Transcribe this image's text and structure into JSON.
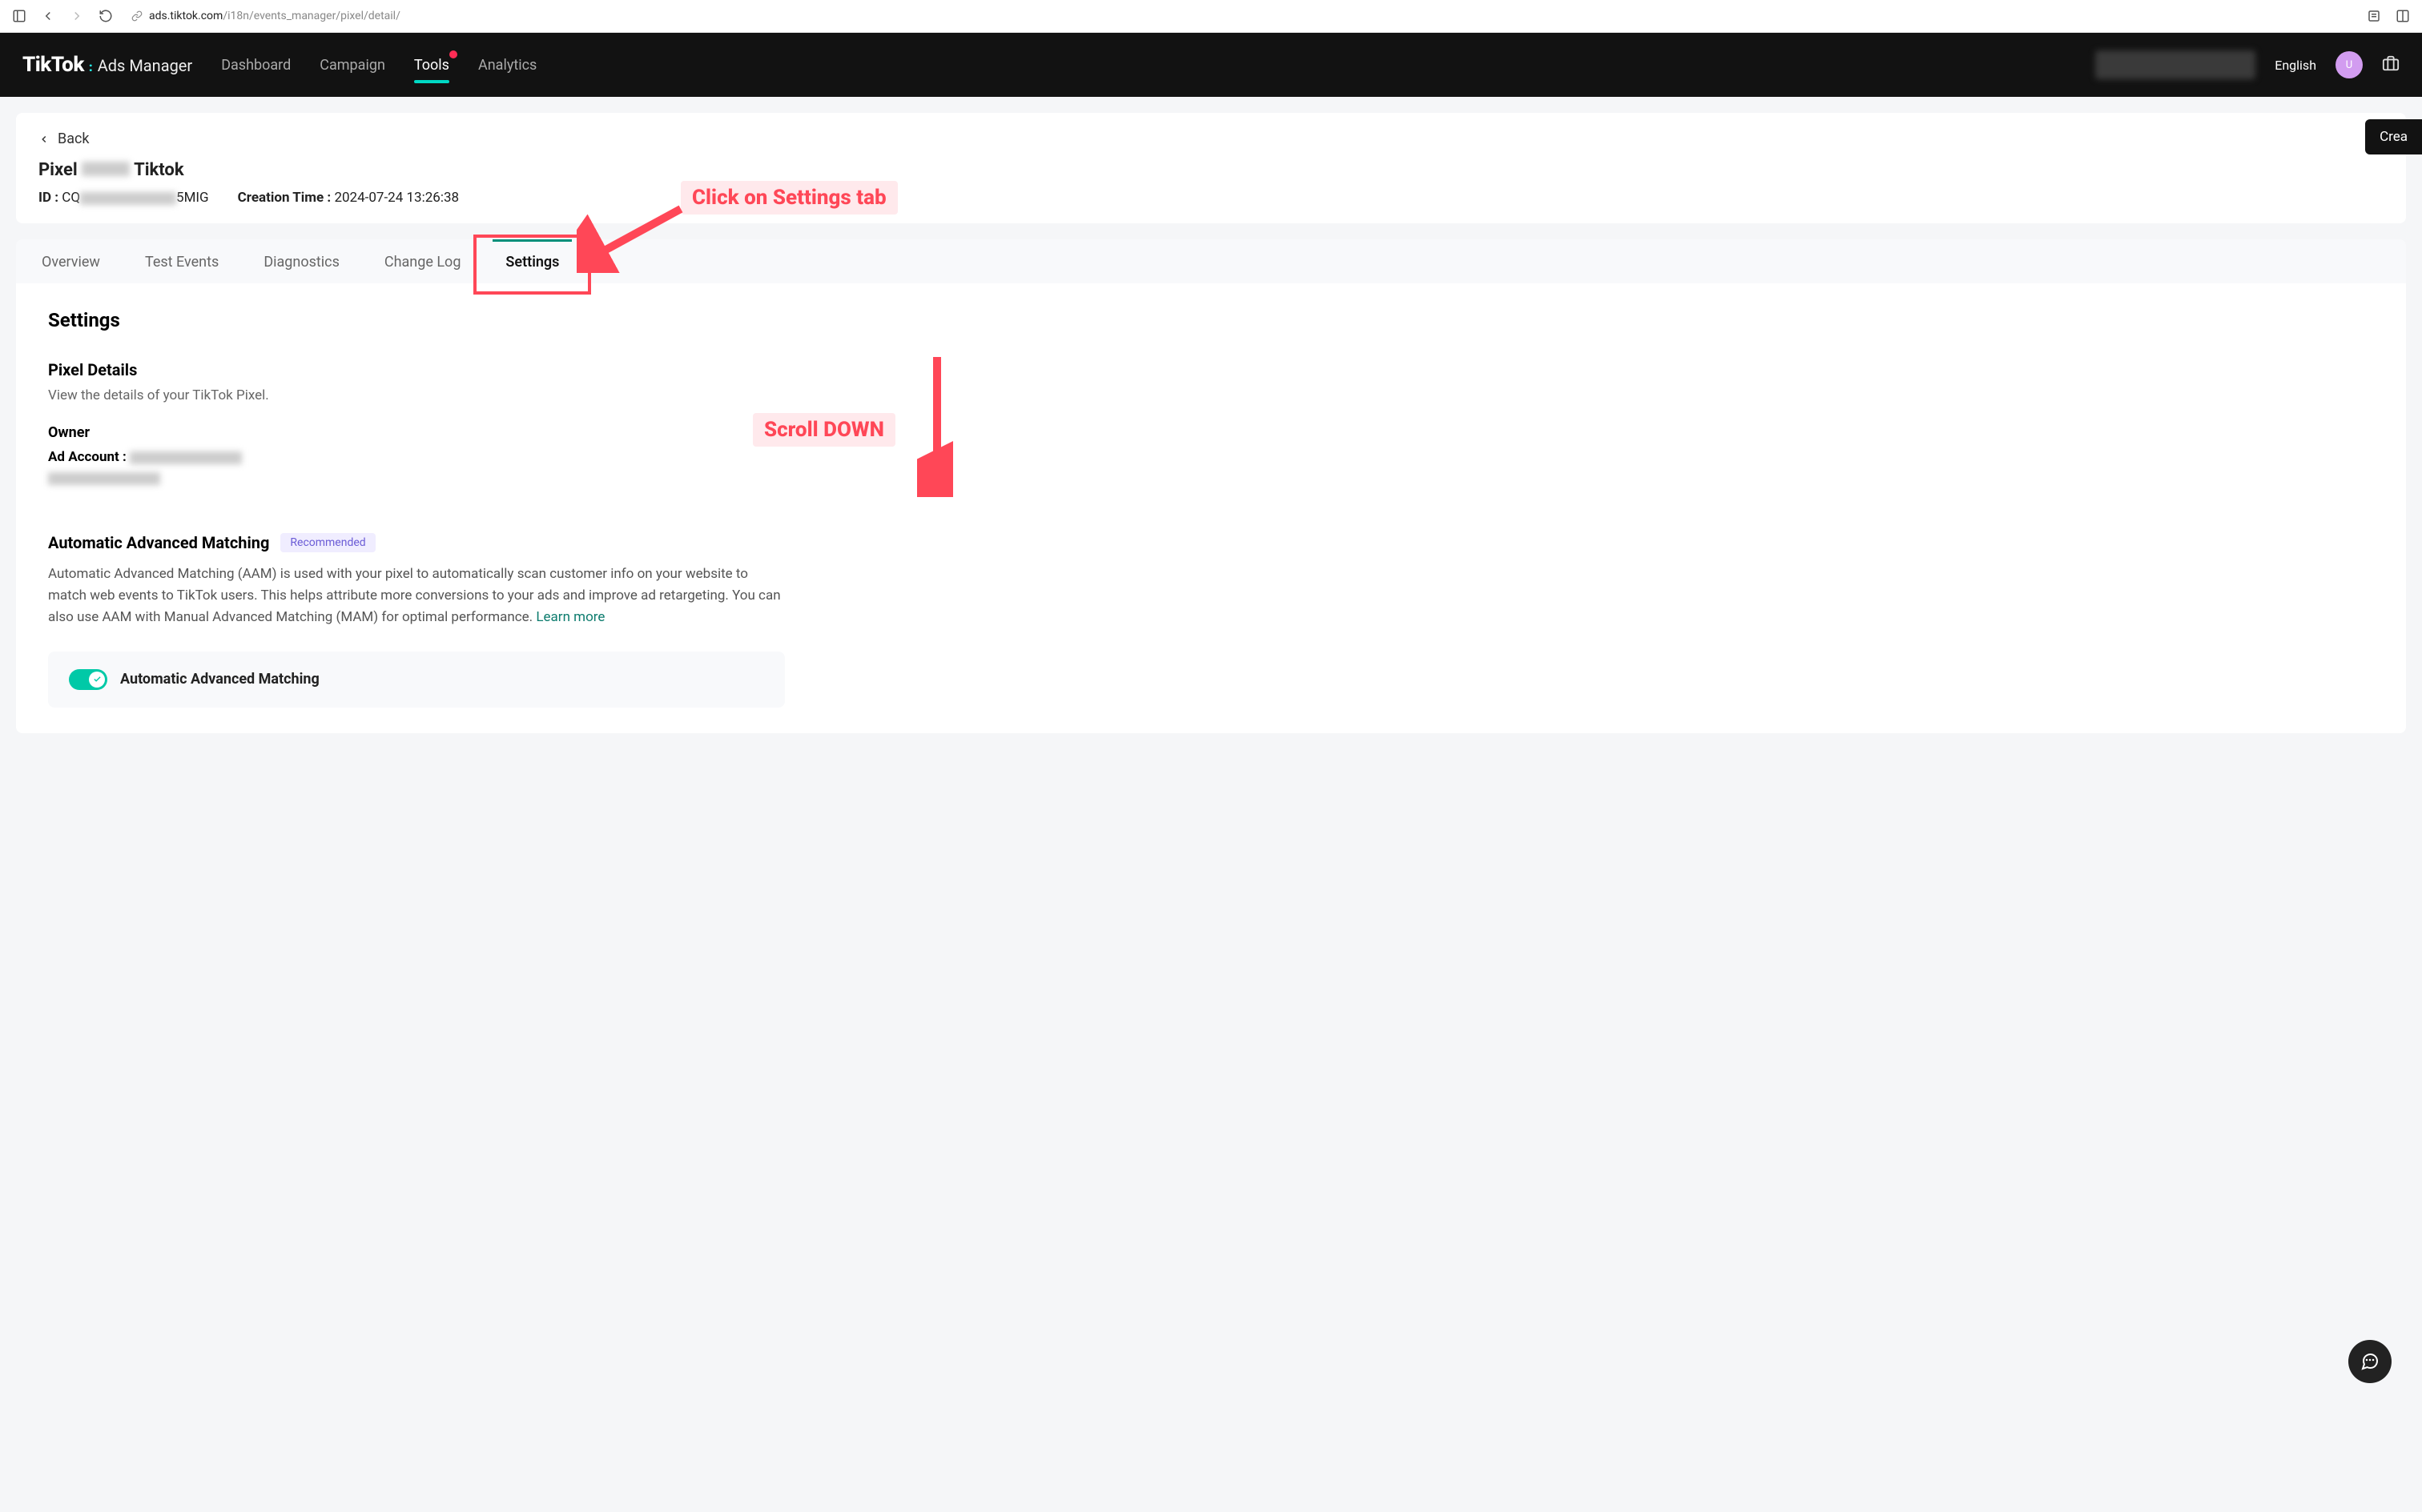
{
  "browser": {
    "url_domain": "ads.tiktok.com",
    "url_path": "/i18n/events_manager/pixel/detail/"
  },
  "header": {
    "logo_main": "TikTok",
    "logo_sub": "Ads Manager",
    "nav": [
      {
        "label": "Dashboard",
        "active": false,
        "badge": false
      },
      {
        "label": "Campaign",
        "active": false,
        "badge": false
      },
      {
        "label": "Tools",
        "active": true,
        "badge": true
      },
      {
        "label": "Analytics",
        "active": false,
        "badge": false
      }
    ],
    "language": "English",
    "avatar_initial": "U"
  },
  "create_button": "Crea",
  "pixel_header": {
    "back_label": "Back",
    "title_prefix": "Pixel",
    "title_suffix": "Tiktok",
    "id_label": "ID : ",
    "id_prefix": "CQ",
    "id_suffix": "5MIG",
    "creation_label": "Creation Time : ",
    "creation_value": "2024-07-24 13:26:38"
  },
  "tabs": [
    {
      "label": "Overview",
      "active": false
    },
    {
      "label": "Test Events",
      "active": false
    },
    {
      "label": "Diagnostics",
      "active": false
    },
    {
      "label": "Change Log",
      "active": false
    },
    {
      "label": "Settings",
      "active": true
    }
  ],
  "settings": {
    "heading": "Settings",
    "pixel_details_title": "Pixel Details",
    "pixel_details_sub": "View the details of your TikTok Pixel.",
    "owner_title": "Owner",
    "ad_account_label": "Ad Account : ",
    "aam_title": "Automatic Advanced Matching",
    "aam_badge": "Recommended",
    "aam_desc": "Automatic Advanced Matching (AAM) is used with your pixel to automatically scan customer info on your website to match web events to TikTok users. This helps attribute more conversions to your ads and improve ad retargeting. You can also use AAM with Manual Advanced Matching (MAM) for optimal performance. ",
    "learn_more": "Learn more",
    "toggle_label": "Automatic Advanced Matching",
    "toggle_on": true
  },
  "annotations": {
    "click_settings": "Click on Settings tab",
    "scroll_down": "Scroll DOWN"
  }
}
